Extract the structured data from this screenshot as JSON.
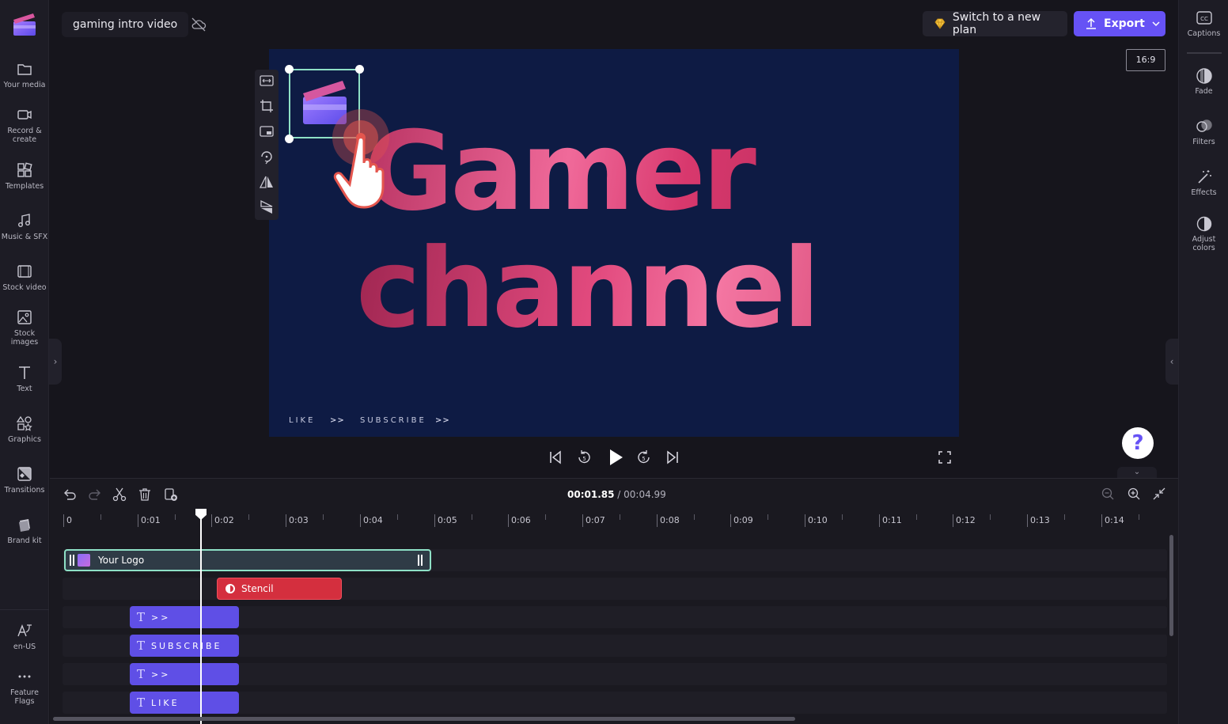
{
  "project": {
    "title": "gaming intro video"
  },
  "topbar": {
    "upgrade_label": "Switch to a new plan",
    "export_label": "Export",
    "aspect_ratio": "16:9"
  },
  "left_rail": {
    "items": [
      {
        "label": "Your media",
        "icon": "folder-icon"
      },
      {
        "label": "Record &",
        "label2": "create",
        "icon": "camera-icon"
      },
      {
        "label": "Templates",
        "icon": "templates-icon"
      },
      {
        "label": "Music & SFX",
        "icon": "music-icon"
      },
      {
        "label": "Stock video",
        "icon": "film-icon"
      },
      {
        "label": "Stock",
        "label2": "images",
        "icon": "image-icon"
      },
      {
        "label": "Text",
        "icon": "text-icon"
      },
      {
        "label": "Graphics",
        "icon": "shapes-icon"
      },
      {
        "label": "Transitions",
        "icon": "transitions-icon"
      },
      {
        "label": "Brand kit",
        "icon": "brand-kit-icon"
      },
      {
        "label": "en-US",
        "icon": "language-icon"
      },
      {
        "label": "Feature",
        "label2": "Flags",
        "icon": "more-icon"
      }
    ]
  },
  "right_rail": {
    "items": [
      {
        "label": "Captions",
        "icon": "captions-icon"
      },
      {
        "label": "Fade",
        "icon": "fade-icon"
      },
      {
        "label": "Filters",
        "icon": "filters-icon"
      },
      {
        "label": "Effects",
        "icon": "magic-wand-icon"
      },
      {
        "label": "Adjust",
        "label2": "colors",
        "icon": "contrast-icon"
      }
    ]
  },
  "preview": {
    "line1": "Gamer",
    "line2": "channel",
    "footer": {
      "like": "LIKE",
      "arrow1": ">>",
      "subscribe": "SUBSCRIBE",
      "arrow2": ">>"
    }
  },
  "playback": {
    "current_time": "00:01.85",
    "total_time": "/ 00:04.99"
  },
  "help": {
    "label": "?"
  },
  "ruler": {
    "labels": [
      "0",
      "0:01",
      "0:02",
      "0:03",
      "0:04",
      "0:05",
      "0:06",
      "0:07",
      "0:08",
      "0:09",
      "0:10",
      "0:11",
      "0:12",
      "0:13",
      "0:14"
    ]
  },
  "tracks": {
    "logo_clip": "Your Logo",
    "stencil_clip": "Stencil",
    "text_clips": [
      ">>",
      "SUBSCRIBE",
      ">>",
      "LIKE"
    ]
  },
  "colors": {
    "accent": "#6652f5",
    "selection": "#8ee0c6",
    "stencil": "#d42f3e",
    "text_clip": "#5f4fe6",
    "preview_bg": "#0e1b44"
  }
}
